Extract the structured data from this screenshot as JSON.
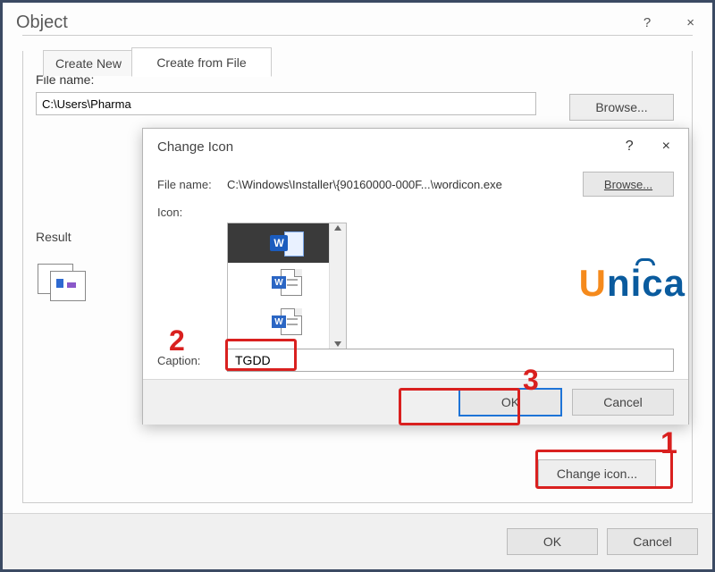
{
  "object_dialog": {
    "title": "Object",
    "help": "?",
    "close": "×",
    "tabs": {
      "create_new": "Create New",
      "create_from_file": "Create from File"
    },
    "file_label": "File name:",
    "file_value": "C:\\Users\\Pharma",
    "browse": "Browse...",
    "result_label": "Result",
    "change_icon": "Change icon...",
    "ok": "OK",
    "cancel": "Cancel"
  },
  "change_icon_dialog": {
    "title": "Change Icon",
    "help": "?",
    "close": "×",
    "file_label": "File name:",
    "file_value": "C:\\Windows\\Installer\\{90160000-000F...\\wordicon.exe",
    "browse": "Browse...",
    "icon_label": "Icon:",
    "caption_label": "Caption:",
    "caption_value": "TGDD",
    "ok": "OK",
    "cancel": "Cancel"
  },
  "callouts": {
    "one": "1",
    "two": "2",
    "three": "3"
  },
  "watermark": {
    "u": "U",
    "rest": "nica"
  }
}
